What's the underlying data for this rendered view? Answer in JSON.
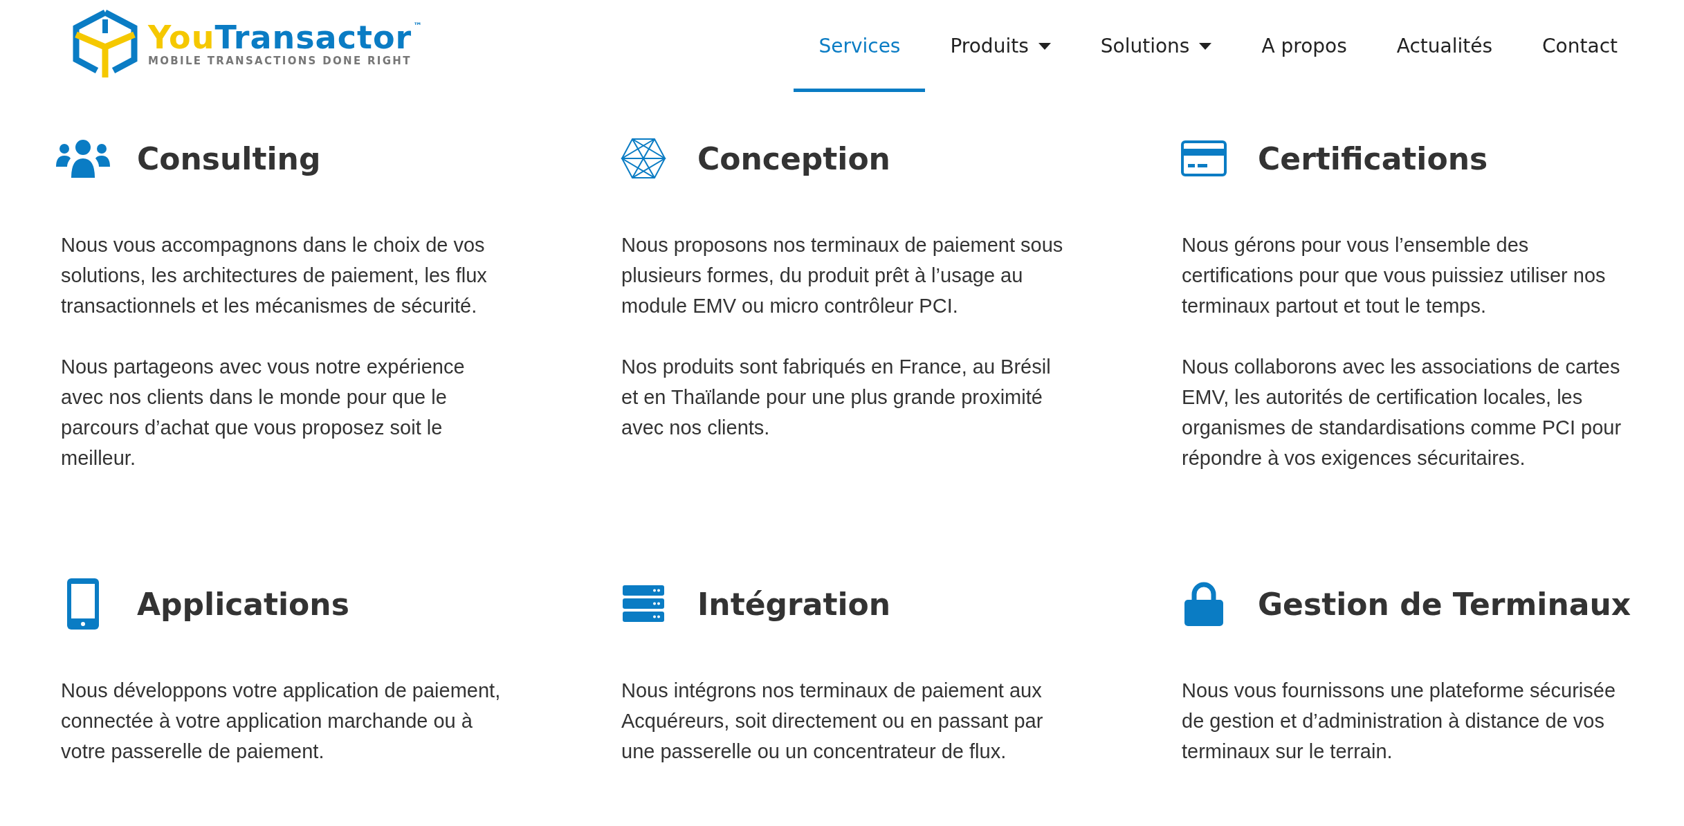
{
  "logo": {
    "brand_first": "You",
    "brand_second": "Transactor",
    "trademark": "™",
    "tagline": "MOBILE TRANSACTIONS DONE RIGHT"
  },
  "nav": [
    {
      "label": "Services",
      "selected": true,
      "dropdown": false
    },
    {
      "label": "Produits",
      "selected": false,
      "dropdown": true
    },
    {
      "label": "Solutions",
      "selected": false,
      "dropdown": true
    },
    {
      "label": "A propos",
      "selected": false,
      "dropdown": false
    },
    {
      "label": "Actualités",
      "selected": false,
      "dropdown": false
    },
    {
      "label": "Contact",
      "selected": false,
      "dropdown": false
    }
  ],
  "services": [
    {
      "title": "Consulting",
      "paragraphs": [
        "Nous vous accompagnons dans le choix de vos solutions, les architectures de paiement, les flux transactionnels et les mécanismes de sécurité.",
        "Nous partageons avec vous notre expérience avec nos clients dans le monde pour que le parcours d’achat que vous proposez soit le meilleur."
      ]
    },
    {
      "title": "Conception",
      "paragraphs": [
        "Nous proposons nos terminaux de paiement sous plusieurs formes, du produit prêt à l’usage au module EMV ou micro contrôleur PCI.",
        "Nos produits sont fabriqués en France, au Brésil et en Thaïlande pour une plus grande proximité avec nos clients."
      ]
    },
    {
      "title": "Certifications",
      "paragraphs": [
        "Nous gérons pour vous l’ensemble des certifications pour que vous puissiez utiliser nos terminaux partout et tout le temps.",
        "Nous collaborons avec les associations de cartes EMV, les autorités de certification locales, les organismes de standardisations comme PCI pour répondre à vos exigences sécuritaires."
      ]
    },
    {
      "title": "Applications",
      "paragraphs": [
        "Nous développons votre application de paiement, connectée à votre application marchande ou à votre passerelle de paiement."
      ]
    },
    {
      "title": "Intégration",
      "paragraphs": [
        "Nous intégrons nos terminaux de paiement aux Acquéreurs, soit directement ou en passant par une passerelle ou un concentrateur de flux."
      ]
    },
    {
      "title": "Gestion de Terminaux",
      "paragraphs": [
        "Nous vous fournissons une plateforme sécurisée de gestion et d’administration à distance de vos terminaux sur le terrain."
      ]
    }
  ]
}
